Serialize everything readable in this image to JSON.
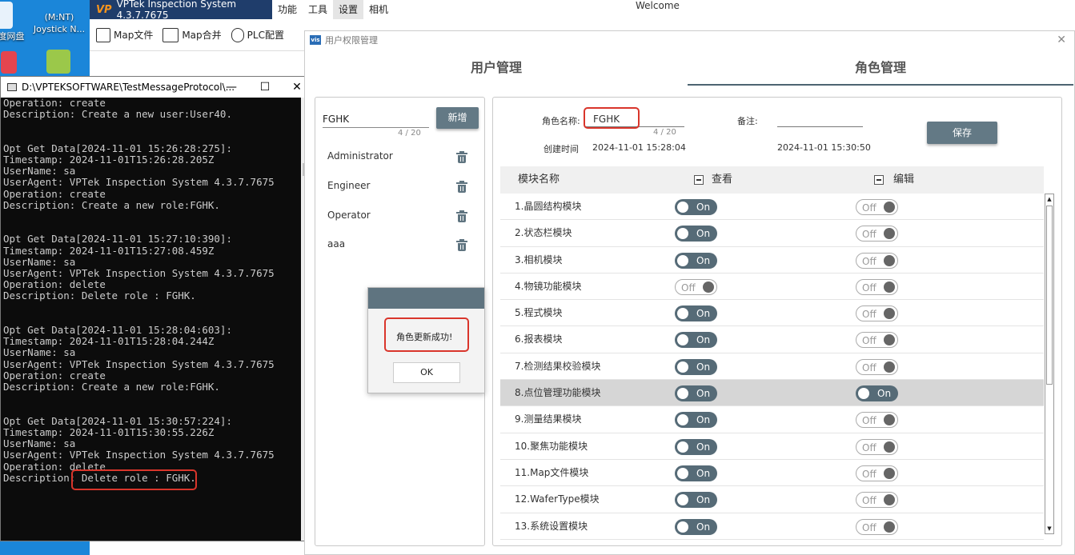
{
  "desktop": {
    "icons": [
      {
        "label": "度网盘"
      },
      {
        "label": "(M:NT)"
      },
      {
        "label": "Joystick N..."
      }
    ]
  },
  "app": {
    "title": "VPTek Inspection System 4.3.7.7675",
    "logo_text": "VP",
    "menu": [
      "功能",
      "工具",
      "设置",
      "相机"
    ],
    "welcome": "Welcome",
    "toolbar": [
      "Map文件",
      "Map合并",
      "PLC配置"
    ]
  },
  "console": {
    "title": "D:\\VPTEKSOFTWARE\\TestMessageProtocol\\...",
    "minimize": "—",
    "maximize": "☐",
    "close": "✕",
    "text": "Operation: create\nDescription: Create a new user:User40.\n\n\nOpt Get Data[2024-11-01 15:26:28:275]:\nTimestamp: 2024-11-01T15:26:28.205Z\nUserName: sa\nUserAgent: VPTek Inspection System 4.3.7.7675\nOperation: create\nDescription: Create a new role:FGHK.\n\n\nOpt Get Data[2024-11-01 15:27:10:390]:\nTimestamp: 2024-11-01T15:27:08.459Z\nUserName: sa\nUserAgent: VPTek Inspection System 4.3.7.7675\nOperation: delete\nDescription: Delete role : FGHK.\n\n\nOpt Get Data[2024-11-01 15:28:04:603]:\nTimestamp: 2024-11-01T15:28:04.244Z\nUserName: sa\nUserAgent: VPTek Inspection System 4.3.7.7675\nOperation: create\nDescription: Create a new role:FGHK.\n\n\nOpt Get Data[2024-11-01 15:30:57:224]:\nTimestamp: 2024-11-01T15:30:55.226Z\nUserName: sa\nUserAgent: VPTek Inspection System 4.3.7.7675\nOperation: delete\nDescription: Delete role : FGHK."
  },
  "perm": {
    "icon_text": "vis",
    "title": "用户权限管理",
    "close": "✕",
    "tabs": [
      "用户管理",
      "角色管理"
    ],
    "active_tab": 1,
    "left": {
      "role_input": "FGHK",
      "counter": "4 / 20",
      "add_button": "新增",
      "roles": [
        "Administrator",
        "Engineer",
        "Operator",
        "aaa"
      ]
    },
    "right": {
      "role_name_label": "角色名称:",
      "role_name_value": "FGHK",
      "role_name_counter": "4 / 20",
      "remark_label": "备注:",
      "remark_value": "",
      "created_label": "创建时间",
      "created_value": "2024-11-01 15:28:04",
      "updated_value": "2024-11-01 15:30:50",
      "save_button": "保存",
      "col_module": "模块名称",
      "col_view": "查看",
      "col_edit": "编辑",
      "modules": [
        {
          "name": "1.晶圆结构模块",
          "view": "On",
          "edit": "Off"
        },
        {
          "name": "2.状态栏模块",
          "view": "On",
          "edit": "Off"
        },
        {
          "name": "3.相机模块",
          "view": "On",
          "edit": "Off"
        },
        {
          "name": "4.物镜功能模块",
          "view": "Off",
          "edit": "Off"
        },
        {
          "name": "5.程式模块",
          "view": "On",
          "edit": "Off"
        },
        {
          "name": "6.报表模块",
          "view": "On",
          "edit": "Off"
        },
        {
          "name": "7.检测结果校验模块",
          "view": "On",
          "edit": "Off"
        },
        {
          "name": "8.点位管理功能模块",
          "view": "On",
          "edit": "On",
          "highlight": true
        },
        {
          "name": "9.测量结果模块",
          "view": "On",
          "edit": "Off"
        },
        {
          "name": "10.聚焦功能模块",
          "view": "On",
          "edit": "Off"
        },
        {
          "name": "11.Map文件模块",
          "view": "On",
          "edit": "Off"
        },
        {
          "name": "12.WaferType模块",
          "view": "On",
          "edit": "Off"
        },
        {
          "name": "13.系统设置模块",
          "view": "On",
          "edit": "Off"
        }
      ]
    }
  },
  "msgbox": {
    "text": "角色更新成功!",
    "ok": "OK"
  },
  "colors": {
    "accent": "#5f7480",
    "toggle_on": "#566b77",
    "highlight_box": "#d9352b",
    "console_bg": "#0c0c0c",
    "desktop_bg": "#1b86d9"
  }
}
